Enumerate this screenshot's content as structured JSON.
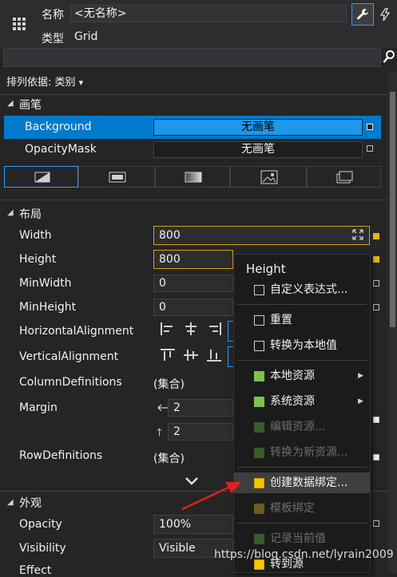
{
  "header": {
    "name_label": "名称",
    "name_value": "<无名称>",
    "type_label": "类型",
    "type_value": "Grid",
    "wrench_icon": "wrench-icon",
    "bolt_icon": "lightning-icon"
  },
  "search": {
    "placeholder": ""
  },
  "sort": {
    "label": "排列依据: 类别",
    "chevron": "▾"
  },
  "brush": {
    "title": "画笔",
    "background_label": "Background",
    "background_value": "无画笔",
    "opacitymask_label": "OpacityMask",
    "opacitymask_value": "无画笔",
    "tabs": [
      "no-brush",
      "solid-color-brush",
      "gradient-brush",
      "image-brush",
      "visual-brush"
    ]
  },
  "layout": {
    "title": "布局",
    "width_label": "Width",
    "width_value": "800",
    "height_label": "Height",
    "height_value": "800",
    "minwidth_label": "MinWidth",
    "minwidth_value": "0",
    "minheight_label": "MinHeight",
    "minheight_value": "0",
    "halign_label": "HorizontalAlignment",
    "valign_label": "VerticalAlignment",
    "coldefs_label": "ColumnDefinitions",
    "coldefs_value": "(集合)",
    "margin_label": "Margin",
    "margin_left": "2",
    "margin_top": "2",
    "rowdefs_label": "RowDefinitions",
    "rowdefs_value": "(集合)"
  },
  "appearance": {
    "title": "外观",
    "opacity_label": "Opacity",
    "opacity_value": "100%",
    "visibility_label": "Visibility",
    "visibility_value": "Visible",
    "effect_label": "Effect"
  },
  "context_menu": {
    "title": "Height",
    "items": [
      {
        "label": "自定义表达式...",
        "enabled": true
      },
      {
        "label": "重置",
        "enabled": true
      },
      {
        "label": "转换为本地值",
        "enabled": true
      },
      {
        "label": "本地资源",
        "enabled": true
      },
      {
        "label": "系统资源",
        "enabled": true
      },
      {
        "label": "编辑资源...",
        "enabled": false
      },
      {
        "label": "转换为新资源...",
        "enabled": false
      },
      {
        "label": "创建数据绑定...",
        "enabled": true
      },
      {
        "label": "模板绑定",
        "enabled": false
      },
      {
        "label": "记录当前值",
        "enabled": false
      },
      {
        "label": "转到源",
        "enabled": true
      }
    ]
  },
  "colors": {
    "accent": "#007acc",
    "background": "#252526",
    "arrow": "#e02020"
  },
  "watermark": "https://blog.csdn.net/lyrain2009"
}
